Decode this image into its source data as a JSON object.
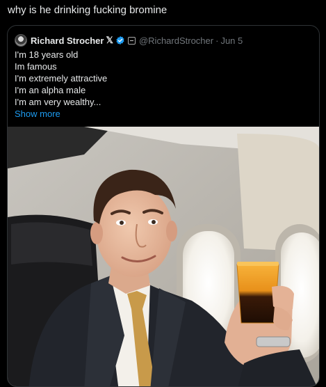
{
  "post": {
    "text": "why is he drinking fucking bromine"
  },
  "quote": {
    "author_name": "Richard Strocher",
    "x_badge": "𝕏",
    "handle": "@RichardStrocher",
    "separator": "·",
    "date": "Jun 5",
    "lines": [
      "I'm 18 years old",
      "Im famous",
      "I'm extremely attractive",
      "I'm an alpha male",
      "I'm am very wealthy..."
    ],
    "show_more": "Show more"
  },
  "colors": {
    "background": "#000000",
    "text": "#e7e9ea",
    "muted": "#71767b",
    "link": "#1d9bf0",
    "border": "#2f3336",
    "verified": "#1d9bf0"
  },
  "icons": {
    "verified": "verified-badge-icon",
    "org": "affiliate-badge-icon"
  }
}
